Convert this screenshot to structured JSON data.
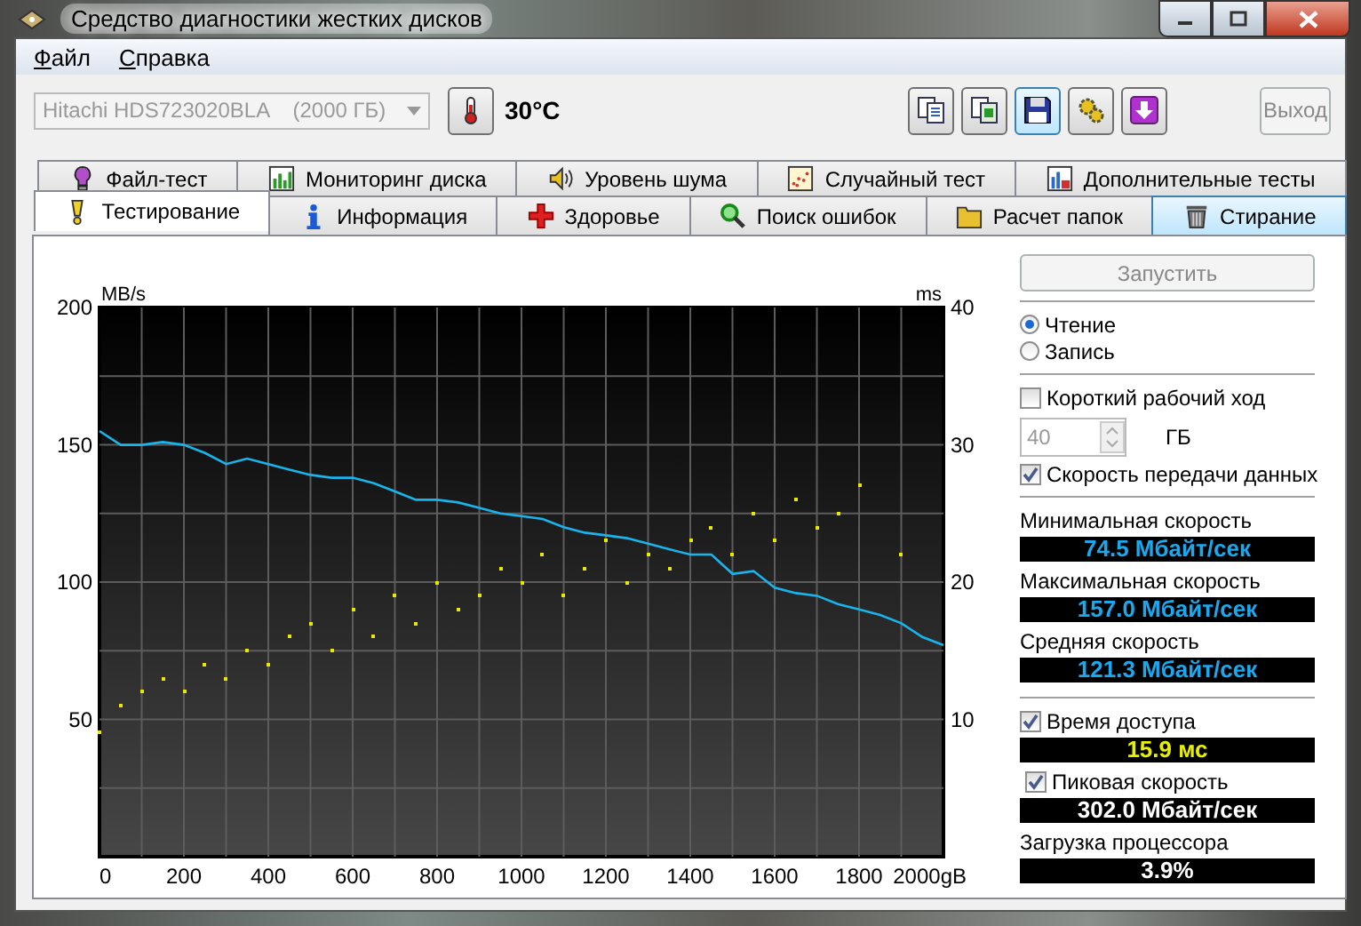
{
  "window": {
    "title": "Средство диагностики жестких дисков"
  },
  "menu": [
    {
      "label": "Файл"
    },
    {
      "label": "Справка"
    }
  ],
  "toolbar": {
    "drive": {
      "value": "Hitachi HDS723020BLA    (2000 ГБ)",
      "disabled": true
    },
    "temperature": "30°C",
    "buttons": [
      {
        "focused": false
      },
      {
        "focused": false
      },
      {
        "focused": true
      },
      {
        "focused": false
      },
      {
        "focused": false
      }
    ],
    "exit_button": {
      "label": "Выход",
      "disabled": true
    }
  },
  "tabs_row1": [
    {
      "label": "Файл-тест",
      "selected": false
    },
    {
      "label": "Мониторинг диска",
      "selected": false
    },
    {
      "label": "Уровень шума",
      "selected": false
    },
    {
      "label": "Случайный тест",
      "selected": false
    },
    {
      "label": "Дополнительные тесты",
      "selected": false
    }
  ],
  "tabs_row2": [
    {
      "label": "Тестирование",
      "selected": true,
      "hovered": false
    },
    {
      "label": "Информация",
      "selected": false,
      "hovered": false
    },
    {
      "label": "Здоровье",
      "selected": false,
      "hovered": false
    },
    {
      "label": "Поиск ошибок",
      "selected": false,
      "hovered": false
    },
    {
      "label": "Расчет папок",
      "selected": false,
      "hovered": false
    },
    {
      "label": "Стирание",
      "selected": false,
      "hovered": true
    }
  ],
  "chart": {
    "chart_data": {
      "type": "line",
      "grid": true,
      "xlim": [
        0,
        2000
      ],
      "ylim": [
        0,
        200
      ],
      "xticks": [
        0,
        200,
        400,
        600,
        800,
        1000,
        1200,
        1400,
        1600,
        1800,
        {
          "value": 2000,
          "label": "2000gB"
        }
      ],
      "yticks": [
        50,
        100,
        150,
        200
      ],
      "x": [
        0,
        50,
        100,
        150,
        200,
        250,
        300,
        350,
        400,
        450,
        500,
        550,
        600,
        650,
        700,
        750,
        800,
        850,
        900,
        950,
        1000,
        1050,
        1100,
        1150,
        1200,
        1250,
        1300,
        1350,
        1400,
        1450,
        1500,
        1550,
        1600,
        1650,
        1700,
        1750,
        1800,
        1850,
        1900,
        1950,
        2000
      ],
      "series": [
        {
          "name": "MB/s",
          "color": "#1ab4ec",
          "values": [
            155,
            150,
            150,
            151,
            150,
            147,
            143,
            145,
            143,
            141,
            139,
            138,
            138,
            136,
            133,
            130,
            130,
            129,
            127,
            125,
            124,
            123,
            120,
            118,
            117,
            116,
            114,
            112,
            110,
            110,
            103,
            104,
            98,
            96,
            95,
            92,
            90,
            88,
            85,
            80,
            77
          ]
        }
      ]
    }
  },
  "access_chart": {
    "chart_data": {
      "type": "scatter",
      "xlim": [
        0,
        2000
      ],
      "ylim": [
        0,
        40
      ],
      "yticks": [
        10,
        20,
        30,
        40
      ],
      "x": [
        0,
        50,
        100,
        150,
        200,
        250,
        300,
        350,
        400,
        450,
        500,
        550,
        600,
        650,
        700,
        750,
        800,
        850,
        900,
        950,
        1000,
        1050,
        1100,
        1150,
        1200,
        1250,
        1300,
        1350,
        1400,
        1450,
        1500,
        1550,
        1600,
        1650,
        1700,
        1750,
        1800,
        1900
      ],
      "series": [
        {
          "name": "ms",
          "color": "#e8e800",
          "values": [
            9,
            11,
            12,
            13,
            12,
            14,
            13,
            15,
            14,
            16,
            17,
            15,
            18,
            16,
            19,
            17,
            20,
            18,
            19,
            21,
            20,
            22,
            19,
            21,
            23,
            20,
            22,
            21,
            23,
            24,
            22,
            25,
            23,
            26,
            24,
            25,
            27,
            22
          ]
        }
      ]
    }
  },
  "panel": {
    "start_button": {
      "label": "Запустить",
      "disabled": true
    },
    "modes": [
      {
        "label": "Чтение",
        "selected": true
      },
      {
        "label": "Запись",
        "selected": false
      }
    ],
    "short_stroke": {
      "label": "Короткий рабочий ход",
      "checked": false
    },
    "stroke_size": {
      "value": "40",
      "unit": "ГБ",
      "disabled": true
    },
    "transfer_rate": {
      "label": "Скорость передачи данных",
      "checked": true
    },
    "transfer_readouts": [
      {
        "label": "Минимальная скорость",
        "value": "74.5 Мбайт/сек"
      },
      {
        "label": "Максимальная скорость",
        "value": "157.0 Мбайт/сек"
      },
      {
        "label": "Средняя скорость",
        "value": "121.3 Мбайт/сек"
      }
    ],
    "access_time": {
      "label": "Время доступа",
      "checked": true,
      "value": "15.9 мс"
    },
    "burst_rate": {
      "label": "Пиковая скорость",
      "checked": true,
      "value": "302.0 Мбайт/сек"
    },
    "cpu_usage": {
      "label": "Загрузка процессора",
      "value": "3.9%"
    }
  }
}
